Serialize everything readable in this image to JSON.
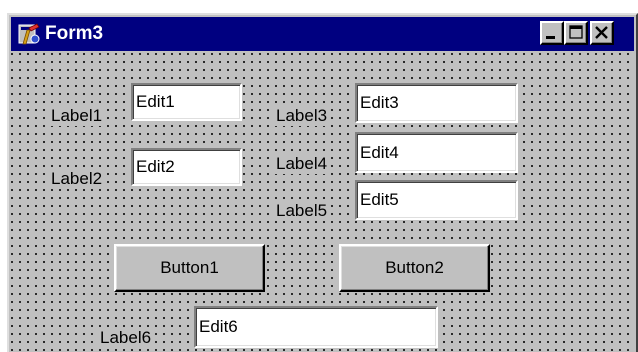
{
  "window": {
    "title": "Form3",
    "titlebar_color": "#000080",
    "face_color": "#c0c0c0",
    "app_icon": "delphi-form-icon",
    "caption_buttons": [
      "minimize-icon",
      "maximize-icon",
      "close-icon"
    ]
  },
  "labels": {
    "label1": "Label1",
    "label2": "Label2",
    "label3": "Label3",
    "label4": "Label4",
    "label5": "Label5",
    "label6": "Label6"
  },
  "edits": {
    "edit1": "Edit1",
    "edit2": "Edit2",
    "edit3": "Edit3",
    "edit4": "Edit4",
    "edit5": "Edit5",
    "edit6": "Edit6"
  },
  "buttons": {
    "button1": "Button1",
    "button2": "Button2"
  }
}
